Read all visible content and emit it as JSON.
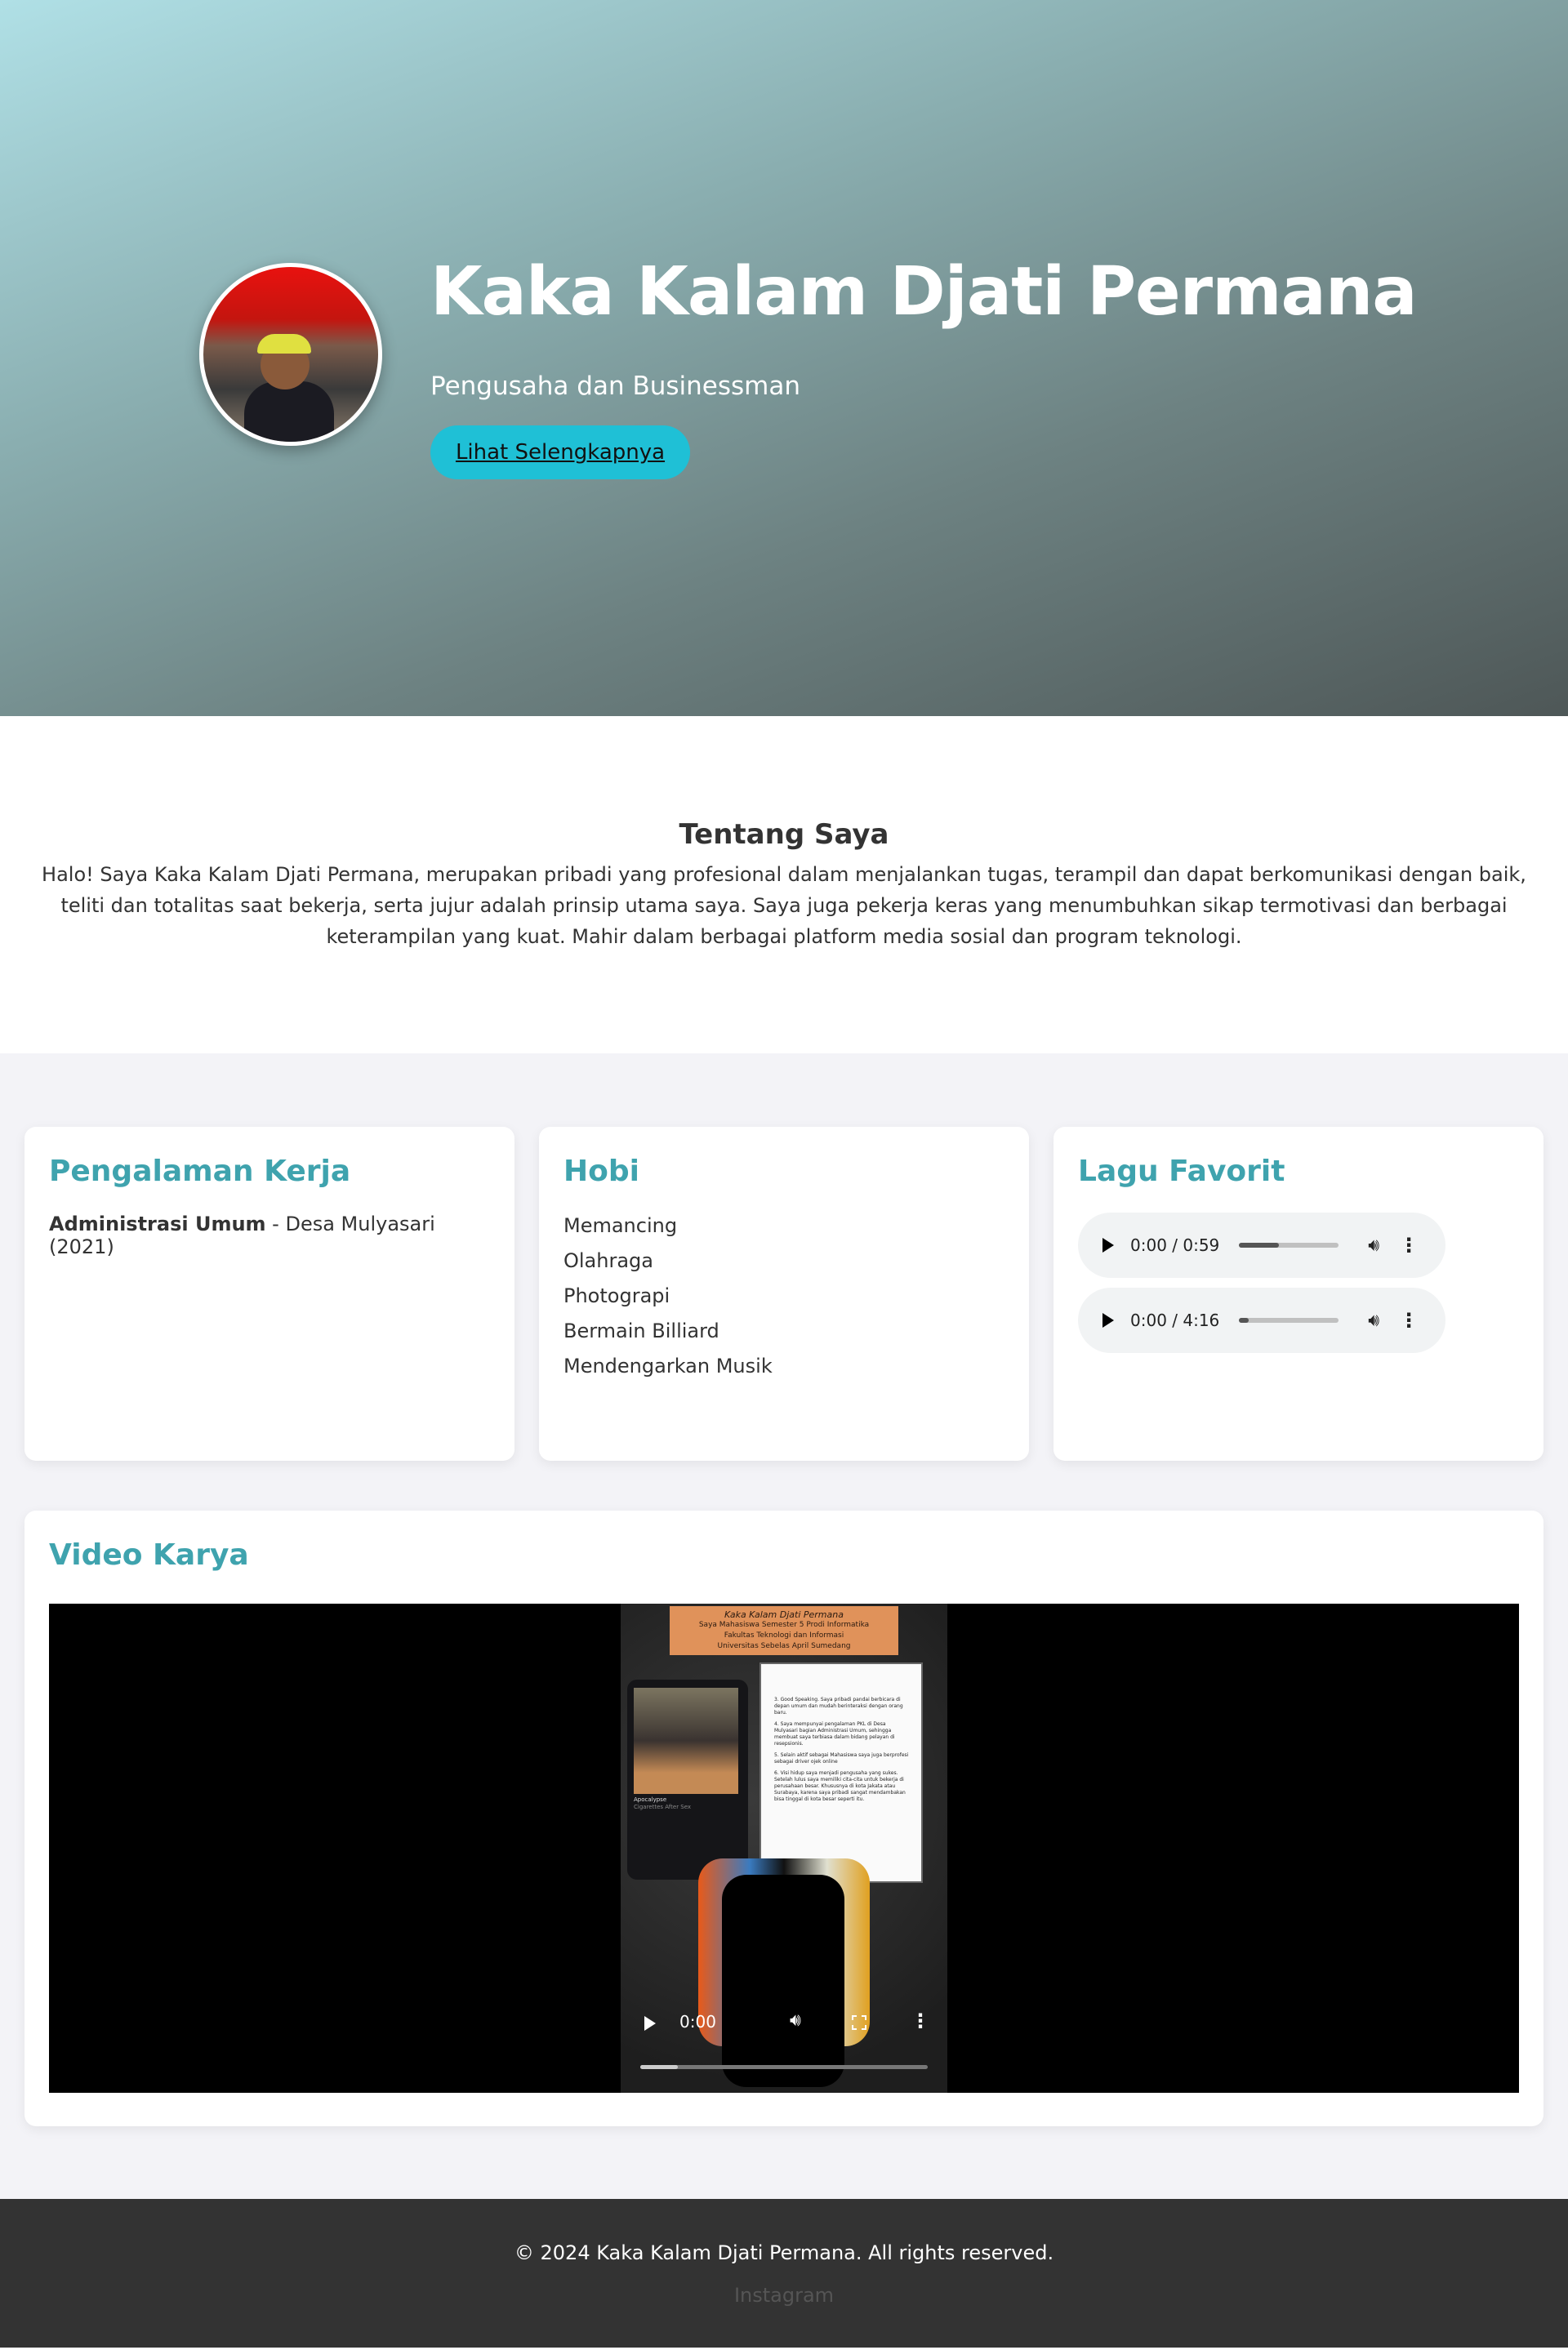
{
  "hero": {
    "name": "Kaka Kalam Djati Permana",
    "subtitle": "Pengusaha dan Businessman",
    "cta_label": "Lihat Selengkapnya",
    "accent_color": "#1fc0d6"
  },
  "about": {
    "title": "Tentang Saya",
    "text": "Halo! Saya Kaka Kalam Djati Permana, merupakan pribadi yang profesional dalam menjalankan tugas, terampil dan dapat berkomunikasi dengan baik, teliti dan totalitas saat bekerja, serta jujur adalah prinsip utama saya. Saya juga pekerja keras yang menumbuhkan sikap termotivasi dan berbagai keterampilan yang kuat. Mahir dalam berbagai platform media sosial dan program teknologi."
  },
  "experience": {
    "title": "Pengalaman Kerja",
    "role": "Administrasi Umum",
    "detail": " - Desa Mulyasari (2021)"
  },
  "hobbies": {
    "title": "Hobi",
    "items": [
      "Memancing",
      "Olahraga",
      "Photograpi",
      "Bermain Billiard",
      "Mendengarkan Musik"
    ]
  },
  "songs": {
    "title": "Lagu Favorit",
    "players": [
      {
        "time": "0:00 / 0:59",
        "volume_fraction": 0.4
      },
      {
        "time": "0:00 / 4:16",
        "volume_fraction": 0.1
      }
    ]
  },
  "video": {
    "title": "Video Karya",
    "time": "0:00",
    "progress_fraction": 0.13,
    "poster": {
      "head_title": "Kaka Kalam Djati Permana",
      "head_line1": "Saya Mahasiswa Semester 5 Prodi Informatika",
      "head_line2": "Fakultas Teknologi dan Informasi",
      "head_line3": "Universitas Sebelas April Sumedang",
      "song_title": "Apocalypse",
      "song_artist": "Cigarettes After Sex",
      "notes": [
        "3. Good Speaking. Saya pribadi pandai berbicara di depan umum dan mudah berinteraksi dengan orang baru.",
        "4. Saya mempunyai pengalaman PKL di Desa Mulyasari bagian Administrasi Umum, sehingga membuat saya terbiasa dalam bidang pelayan di resepsionis.",
        "5. Selain aktif sebagai Mahasiswa saya juga berprofesi sebagai driver ojek online",
        "6. Visi hidup saya menjadi pengusaha yang sukes. Setelah lulus saya memiliki cita-cita untuk bekerja di perusahaan besar. Khususnya di kota Jakata atau Surabaya, karena saya pribadi sangat mendambakan bisa tinggal di kota besar seperti itu."
      ]
    }
  },
  "footer": {
    "copyright": "© 2024 Kaka Kalam Djati Permana. All rights reserved.",
    "instagram_label": "Instagram"
  },
  "colors": {
    "heading": "#3fa3ae",
    "footer_bg": "#333333",
    "section_bg": "#f3f3f7"
  }
}
